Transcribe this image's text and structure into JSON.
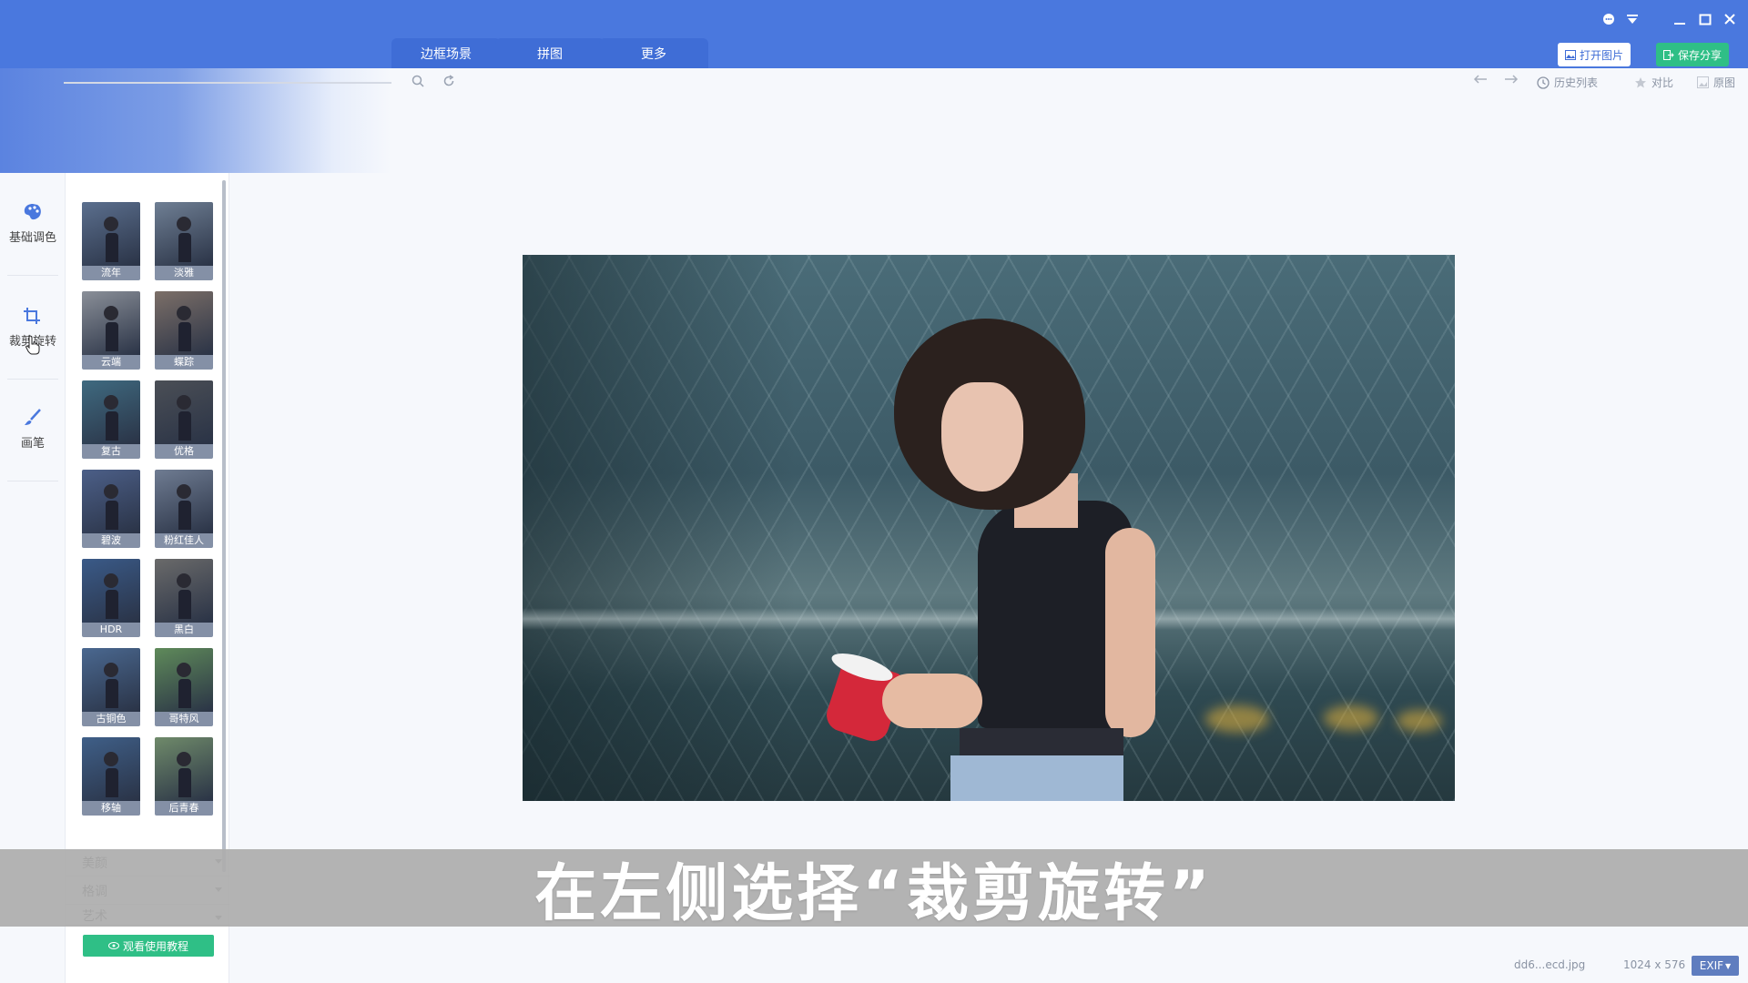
{
  "window": {
    "controls": [
      "chat-bubble-icon",
      "dropdown-icon",
      "minimize-icon",
      "maximize-icon",
      "close-icon"
    ]
  },
  "tabs": [
    "边框场景",
    "拼图",
    "更多"
  ],
  "header_buttons": {
    "open_label": "打开图片",
    "save_label": "保存分享"
  },
  "toolbar": {
    "history_label": "历史列表",
    "compare_label": "对比",
    "original_label": "原图"
  },
  "rail": [
    {
      "label": "基础调色",
      "icon": "palette-icon"
    },
    {
      "label": "裁剪旋转",
      "icon": "crop-icon"
    },
    {
      "label": "画笔",
      "icon": "brush-icon"
    }
  ],
  "filters": [
    {
      "label": "流年",
      "color": "#5b6f8e"
    },
    {
      "label": "淡雅",
      "color": "#6f7f94"
    },
    {
      "label": "云端",
      "color": "#8a8f98"
    },
    {
      "label": "蝶踪",
      "color": "#7c6f68"
    },
    {
      "label": "复古",
      "color": "#3f6a80"
    },
    {
      "label": "优格",
      "color": "#4b4f56"
    },
    {
      "label": "碧波",
      "color": "#4c5f88"
    },
    {
      "label": "粉红佳人",
      "color": "#6f7c92"
    },
    {
      "label": "HDR",
      "color": "#3a5a88"
    },
    {
      "label": "黑白",
      "color": "#6a6a6a"
    },
    {
      "label": "古铜色",
      "color": "#4a6890"
    },
    {
      "label": "哥特风",
      "color": "#5f8a5a"
    },
    {
      "label": "移轴",
      "color": "#3f5f88"
    },
    {
      "label": "后青春",
      "color": "#6f8a6a"
    }
  ],
  "categories": [
    "美颜",
    "格调",
    "艺术"
  ],
  "tutorial_label": "观看使用教程",
  "subtitle": "在左侧选择“裁剪旋转”",
  "status": {
    "filename": "dd6...ecd.jpg",
    "dimensions": "1024 x 576",
    "exif_label": "EXIF"
  },
  "colors": {
    "header_bg": "#4a78de",
    "tab_bg": "#3f6dd6",
    "accent_green": "#2fbf86",
    "exif_bg": "#5f7dbf"
  }
}
